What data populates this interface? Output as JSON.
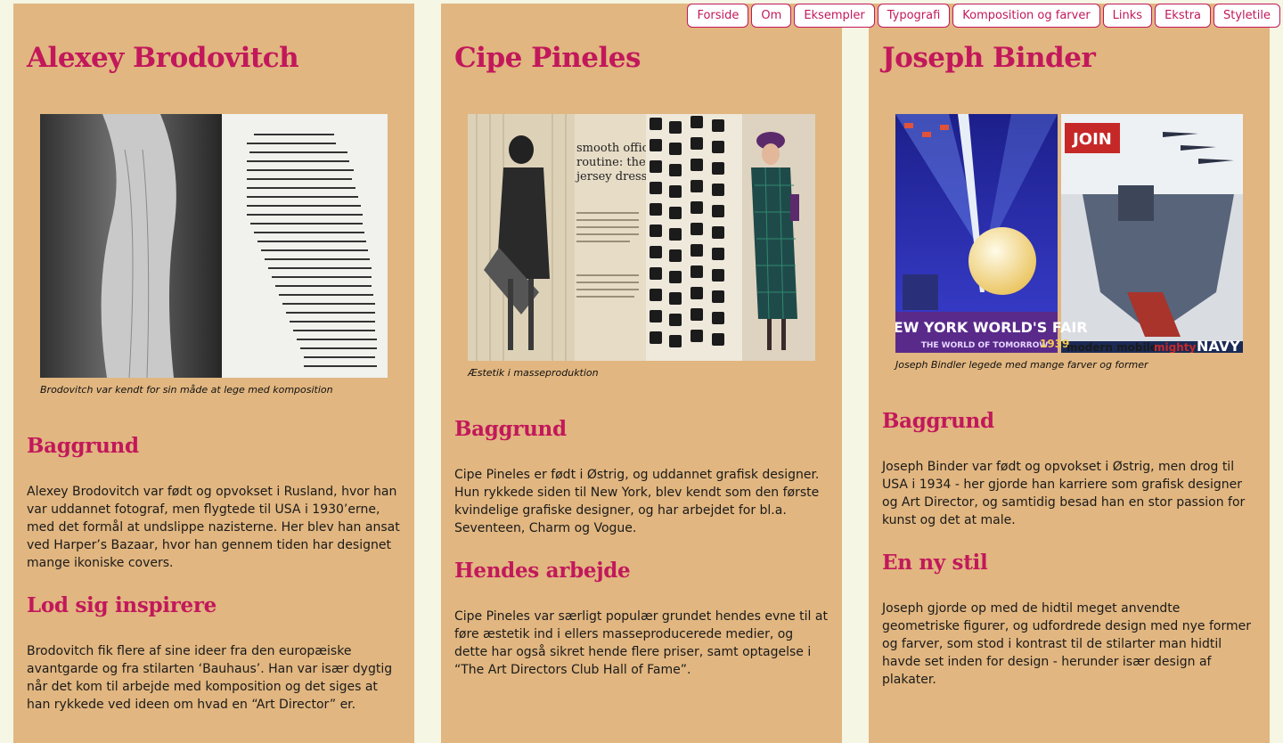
{
  "nav": [
    "Forside",
    "Om",
    "Eksempler",
    "Typografi",
    "Komposition og farver",
    "Links",
    "Ekstra",
    "Styletile"
  ],
  "colors": {
    "accent": "#c2185b",
    "panel": "#e1b680",
    "background": "#f5f6e3"
  },
  "columns": [
    {
      "title": "Alexey Brodovitch",
      "caption": "Brodovitch var kendt for sin måde at lege med komposition",
      "sections": [
        {
          "heading": "Baggrund",
          "text": "Alexey Brodovitch var født og opvokset i Rusland, hvor han var uddannet fotograf, men flygtede til USA i 1930’erne, med det formål at undslippe nazisterne. Her blev han ansat ved Harper’s Bazaar, hvor han gennem tiden har designet mange ikoniske covers."
        },
        {
          "heading": "Lod sig inspirere",
          "text": "Brodovitch fik flere af sine ideer fra den europæiske avantgarde og fra stilarten ‘Bauhaus’. Han var især dygtig når det kom til arbejde med komposition og det siges at han rykkede ved ideen om hvad en “Art Director” er."
        }
      ]
    },
    {
      "title": "Cipe Pineles",
      "image_text": "smooth office routine: the jersey dress",
      "caption": "Æstetik i masseproduktion",
      "sections": [
        {
          "heading": "Baggrund",
          "text": "Cipe Pineles er født i Østrig, og uddannet grafisk designer. Hun rykkede siden til New York, blev kendt som den første kvindelige grafiske designer, og har arbejdet for bl.a. Seventeen, Charm og Vogue."
        },
        {
          "heading": "Hendes arbejde",
          "text": "Cipe Pineles var særligt populær grundet hendes evne til at føre æstetik ind i ellers masseproducerede medier, og dette har også sikret hende flere priser, samt optagelse i “The Art Directors Club Hall of Fame”."
        }
      ]
    },
    {
      "title": "Joseph Binder",
      "poster1_text": "NEW YORK WORLD'S FAIR",
      "poster1_sub": "THE WORLD OF TOMORROW",
      "poster1_year": "1939",
      "poster2_join": "JOIN",
      "poster2_text": "modern mobile",
      "poster2_mighty": "mighty",
      "poster2_navy": "NAVY",
      "caption": "Joseph Bindler legede med mange farver og former",
      "sections": [
        {
          "heading": "Baggrund",
          "text": "Joseph Binder var født og opvokset i Østrig, men drog til USA i 1934 - her gjorde han karriere som grafisk designer og Art Director, og samtidig besad han en stor passion for kunst og det at male."
        },
        {
          "heading": "En ny stil",
          "text": "Joseph gjorde op med de hidtil meget anvendte geometriske figurer, og udfordrede design med nye former og farver, som stod i kontrast til de stilarter man hidtil havde set inden for design - herunder især design af plakater."
        }
      ]
    }
  ]
}
